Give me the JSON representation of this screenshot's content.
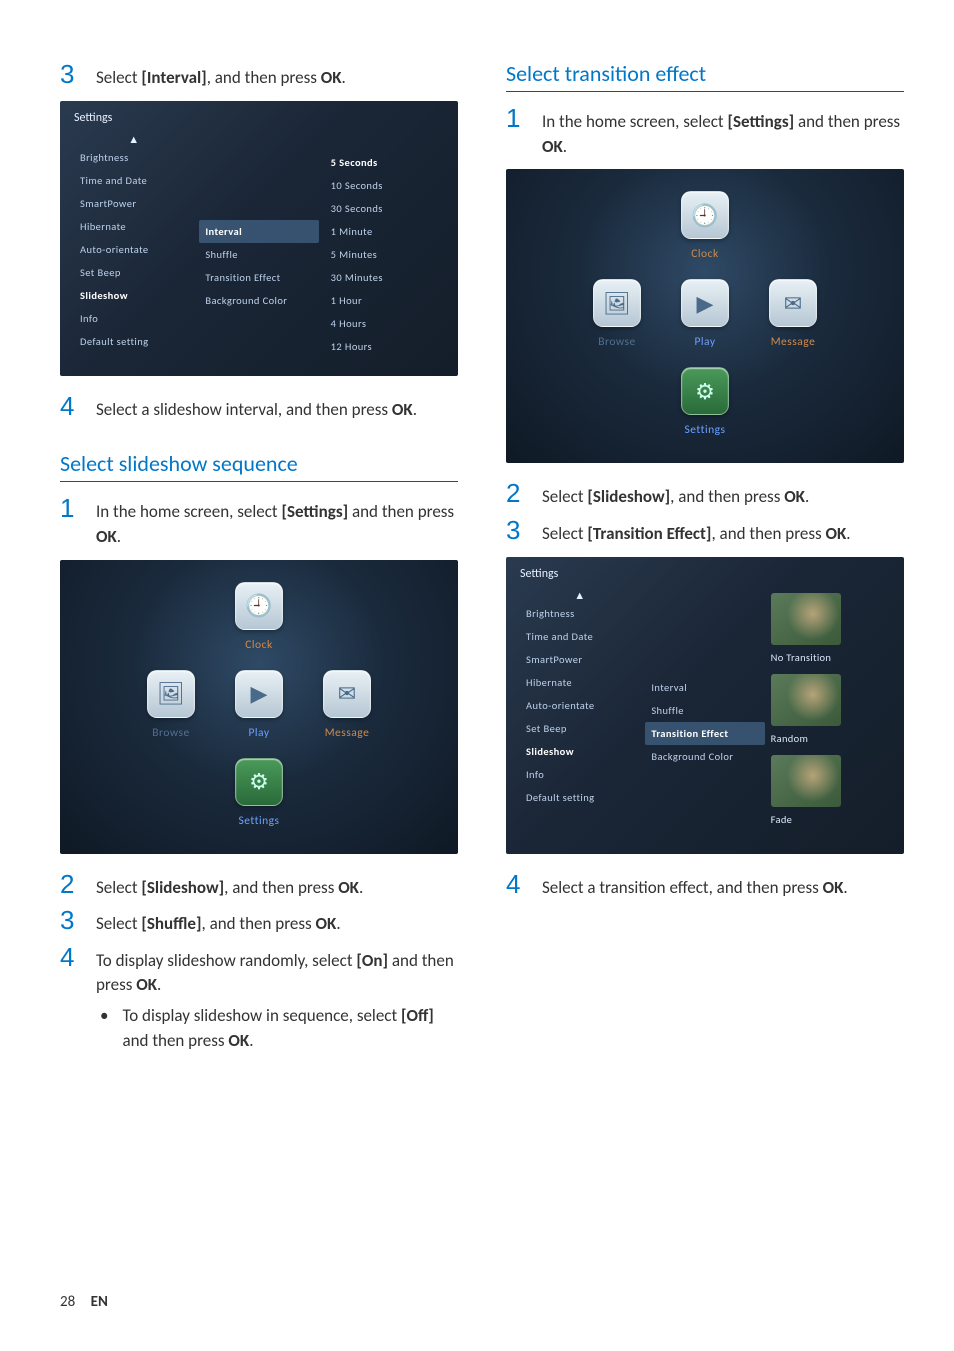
{
  "left": {
    "step3": {
      "before": "Select ",
      "term": "[Interval]",
      "mid": ", and then press ",
      "ok": "OK",
      "after": "."
    },
    "shot1": {
      "title": "Settings",
      "col1": [
        "Brightness",
        "Time and Date",
        "SmartPower",
        "Hibernate",
        "Auto-orientate",
        "Set Beep",
        "Slideshow",
        "Info",
        "Default setting"
      ],
      "col1_selected_index": 6,
      "col2": [
        "Interval",
        "Shuffle",
        "Transition Effect",
        "Background Color"
      ],
      "col2_selected_index": 0,
      "col3": [
        "5 Seconds",
        "10 Seconds",
        "30 Seconds",
        "1 Minute",
        "5 Minutes",
        "30 Minutes",
        "1 Hour",
        "4 Hours",
        "12 Hours"
      ],
      "col3_selected_index": 0
    },
    "step4": {
      "text_a": "Select a slideshow interval, and then press ",
      "ok": "OK",
      "after": "."
    },
    "heading": "Select slideshow sequence",
    "seq1": {
      "a": "In the home screen, select ",
      "b": "[Settings]",
      "c": " and then press ",
      "ok": "OK",
      "after": "."
    },
    "home": {
      "items_row": [
        "Browse",
        "Play",
        "Message"
      ],
      "top": "Clock",
      "bottom": "Settings"
    },
    "seq2": {
      "a": "Select ",
      "b": "[Slideshow]",
      "c": ", and then press ",
      "ok": "OK",
      "after": "."
    },
    "seq3": {
      "a": "Select ",
      "b": "[Shuffle]",
      "c": ", and then press ",
      "ok": "OK",
      "after": "."
    },
    "seq4": {
      "a": "To display slideshow randomly, select ",
      "b": "[On]",
      "c": " and then press ",
      "ok": "OK",
      "after": "."
    },
    "seq4b": {
      "a": "To display slideshow in sequence, select ",
      "b": "[Off]",
      "c": " and then press ",
      "ok": "OK",
      "after": "."
    }
  },
  "right": {
    "heading": "Select transition effect",
    "t1": {
      "a": "In the home screen, select ",
      "b": "[Settings]",
      "c": " and then press ",
      "ok": "OK",
      "after": "."
    },
    "t2": {
      "a": "Select ",
      "b": "[Slideshow]",
      "c": ", and then press ",
      "ok": "OK",
      "after": "."
    },
    "t3": {
      "a": "Select ",
      "b": "[Transition Effect]",
      "c": ", and then press ",
      "ok": "OK",
      "after": "."
    },
    "shot2": {
      "title": "Settings",
      "col1": [
        "Brightness",
        "Time and Date",
        "SmartPower",
        "Hibernate",
        "Auto-orientate",
        "Set Beep",
        "Slideshow",
        "Info",
        "Default setting"
      ],
      "col1_selected_index": 6,
      "col2": [
        "Interval",
        "Shuffle",
        "Transition Effect",
        "Background Color"
      ],
      "col2_selected_index": 2,
      "col3_labels": [
        "No Transition",
        "Random",
        "Fade"
      ]
    },
    "t4": {
      "a": "Select a transition effect, and then press ",
      "ok": "OK",
      "after": "."
    }
  },
  "footer": {
    "page": "28",
    "lang": "EN"
  },
  "home_labels": {
    "browse": "Browse",
    "play": "Play",
    "message": "Message",
    "settings": "Settings",
    "clock": "Clock"
  }
}
